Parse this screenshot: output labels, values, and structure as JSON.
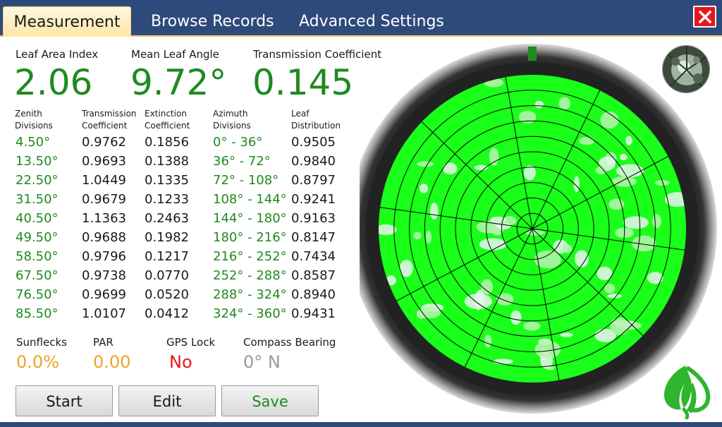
{
  "tabs": {
    "measurement": "Measurement",
    "browse": "Browse Records",
    "advanced": "Advanced Settings"
  },
  "summary": {
    "lai_label": "Leaf Area Index",
    "lai_value": "2.06",
    "mla_label": "Mean Leaf Angle",
    "mla_value": "9.72°",
    "tc_label": "Transmission Coefficient",
    "tc_value": "0.145"
  },
  "table": {
    "headers": {
      "zenith": [
        "Zenith",
        "Divisions"
      ],
      "transmission": [
        "Transmission",
        "Coefficient"
      ],
      "extinction": [
        "Extinction",
        "Coefficient"
      ],
      "azimuth": [
        "Azimuth",
        "Divisions"
      ],
      "leaf": [
        "Leaf",
        "Distribution"
      ]
    },
    "rows": [
      {
        "zenith": "4.50°",
        "transmission": "0.9762",
        "extinction": "0.1856",
        "azimuth": "0° - 36°",
        "leaf": "0.9505"
      },
      {
        "zenith": "13.50°",
        "transmission": "0.9693",
        "extinction": "0.1388",
        "azimuth": "36° - 72°",
        "leaf": "0.9840"
      },
      {
        "zenith": "22.50°",
        "transmission": "1.0449",
        "extinction": "0.1335",
        "azimuth": "72° - 108°",
        "leaf": "0.8797"
      },
      {
        "zenith": "31.50°",
        "transmission": "0.9679",
        "extinction": "0.1233",
        "azimuth": "108° - 144°",
        "leaf": "0.9241"
      },
      {
        "zenith": "40.50°",
        "transmission": "1.1363",
        "extinction": "0.2463",
        "azimuth": "144° - 180°",
        "leaf": "0.9163"
      },
      {
        "zenith": "49.50°",
        "transmission": "0.9688",
        "extinction": "0.1982",
        "azimuth": "180° - 216°",
        "leaf": "0.8147"
      },
      {
        "zenith": "58.50°",
        "transmission": "0.9796",
        "extinction": "0.1217",
        "azimuth": "216° - 252°",
        "leaf": "0.7434"
      },
      {
        "zenith": "67.50°",
        "transmission": "0.9738",
        "extinction": "0.0770",
        "azimuth": "252° - 288°",
        "leaf": "0.8587"
      },
      {
        "zenith": "76.50°",
        "transmission": "0.9699",
        "extinction": "0.0520",
        "azimuth": "288° - 324°",
        "leaf": "0.8940"
      },
      {
        "zenith": "85.50°",
        "transmission": "1.0107",
        "extinction": "0.0412",
        "azimuth": "324° - 360°",
        "leaf": "0.9431"
      }
    ]
  },
  "status": {
    "sunflecks_label": "Sunflecks",
    "sunflecks_value": "0.0%",
    "par_label": "PAR",
    "par_value": "0.00",
    "gps_label": "GPS Lock",
    "gps_value": "No",
    "compass_label": "Compass Bearing",
    "compass_value": "0° N"
  },
  "buttons": {
    "start": "Start",
    "edit": "Edit",
    "save": "Save"
  },
  "colors": {
    "header_bar": "#2e4a7a",
    "value_green": "#1f8a1f",
    "canopy_green": "#19ff19",
    "warning_orange": "#f0a22a",
    "error_red": "#e8161a",
    "muted_gray": "#9a9a9a"
  },
  "icons": {
    "close": "close-icon",
    "logo": "leaf-logo-icon",
    "thumbnail": "canopy-thumbnail"
  }
}
